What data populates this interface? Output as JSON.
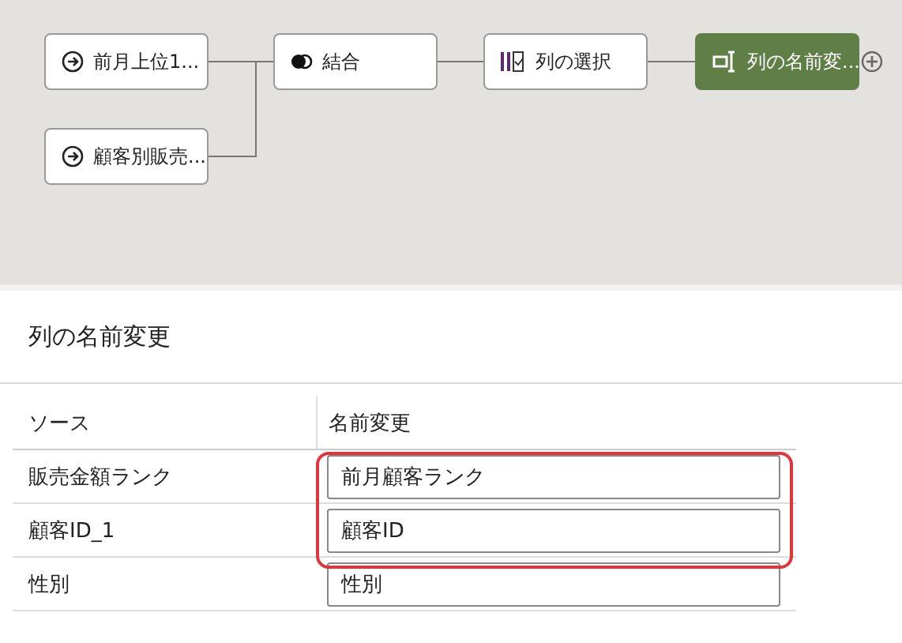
{
  "flow": {
    "nodes": [
      {
        "label": "前月上位1...",
        "kind": "input",
        "selected": false
      },
      {
        "label": "顧客別販売...",
        "kind": "input",
        "selected": false
      },
      {
        "label": "結合",
        "kind": "join",
        "selected": false
      },
      {
        "label": "列の選択",
        "kind": "select",
        "selected": false
      },
      {
        "label": "列の名前変...",
        "kind": "rename",
        "selected": true
      }
    ]
  },
  "panel": {
    "title": "列の名前変更",
    "columns": [
      "ソース",
      "名前変更"
    ],
    "rows": [
      {
        "source": "販売金額ランク",
        "rename": "前月顧客ランク",
        "highlighted": true
      },
      {
        "source": "顧客ID_1",
        "rename": "顧客ID",
        "highlighted": true
      },
      {
        "source": "性別",
        "rename": "性別",
        "highlighted": false
      }
    ]
  }
}
